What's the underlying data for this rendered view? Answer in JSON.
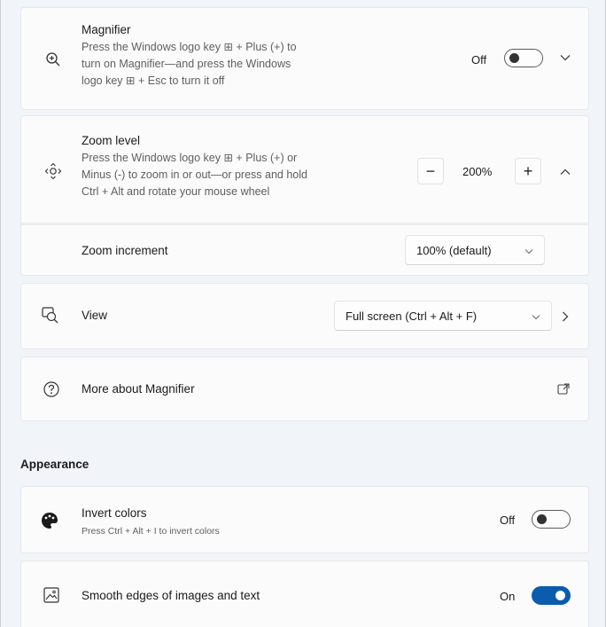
{
  "magnifier": {
    "title": "Magnifier",
    "desc_line1": "Press the Windows logo key ⊞ + Plus (+) to",
    "desc_line2": "turn on Magnifier—and press the Windows",
    "desc_line3": "logo key ⊞ + Esc to turn it off",
    "state": "Off",
    "toggle_on": false,
    "icon": "zoom-in-icon"
  },
  "zoom_level": {
    "title": "Zoom level",
    "desc_line1": "Press the Windows logo key ⊞ + Plus (+) or",
    "desc_line2": "Minus (-) to zoom in or out—or press and hold",
    "desc_line3": "Ctrl + Alt and rotate your mouse wheel",
    "minus": "−",
    "value": "200%",
    "plus": "+",
    "icon": "move-arrows-icon"
  },
  "zoom_increment": {
    "label": "Zoom increment",
    "value": "100% (default)"
  },
  "view": {
    "label": "View",
    "value": "Full screen (Ctrl + Alt + F)",
    "icon": "magnifier-view-icon"
  },
  "more": {
    "label": "More about Magnifier",
    "icon": "help-circle-icon",
    "link_icon": "open-external-icon"
  },
  "appearance": {
    "section_title": "Appearance",
    "invert": {
      "title": "Invert colors",
      "desc": "Press Ctrl + Alt + I to invert colors",
      "state": "Off",
      "toggle_on": false,
      "icon": "palette-icon"
    },
    "smooth": {
      "label": "Smooth edges of images and text",
      "state": "On",
      "toggle_on": true,
      "icon": "image-icon"
    }
  },
  "colors": {
    "accent": "#0b5cad"
  }
}
